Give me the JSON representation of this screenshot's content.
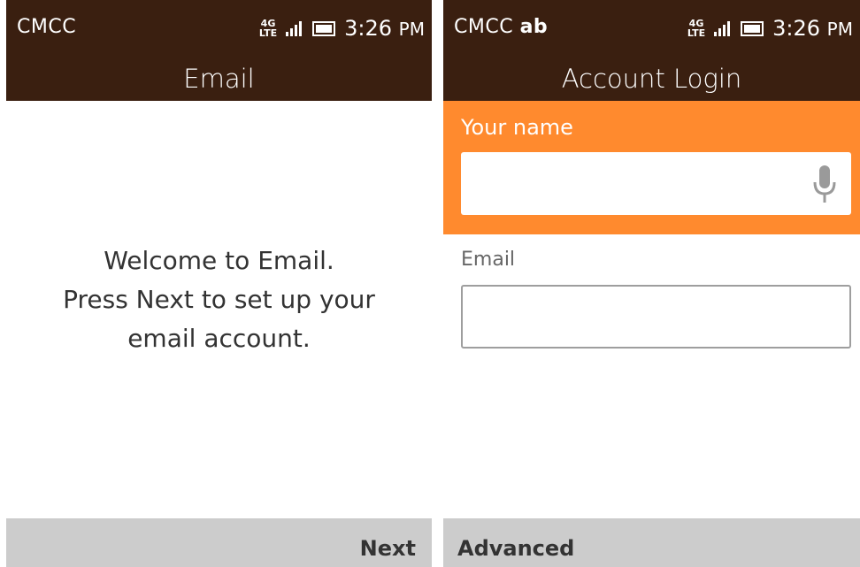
{
  "left_screen": {
    "status": {
      "carrier": "CMCC",
      "network_top": "4G",
      "network_bottom": "LTE",
      "time": "3:26",
      "ampm": "PM"
    },
    "title": "Email",
    "welcome_lines": [
      "Welcome to Email.",
      "Press Next to set up your",
      "email account."
    ],
    "softkeys": {
      "right": "Next"
    }
  },
  "right_screen": {
    "status": {
      "carrier": "CMCC",
      "input_mode": "ab",
      "network_top": "4G",
      "network_bottom": "LTE",
      "time": "3:26",
      "ampm": "PM"
    },
    "title": "Account Login",
    "form": {
      "name_label": "Your name",
      "name_value": "",
      "email_label": "Email",
      "email_value": ""
    },
    "softkeys": {
      "left": "Advanced"
    }
  },
  "colors": {
    "header_bg": "#3a1f10",
    "focus_bg": "#ff8a2e",
    "softkey_bg": "#cccccc"
  },
  "icons": {
    "signal": "signal-bars-icon",
    "battery": "battery-icon",
    "mic": "microphone-icon"
  }
}
